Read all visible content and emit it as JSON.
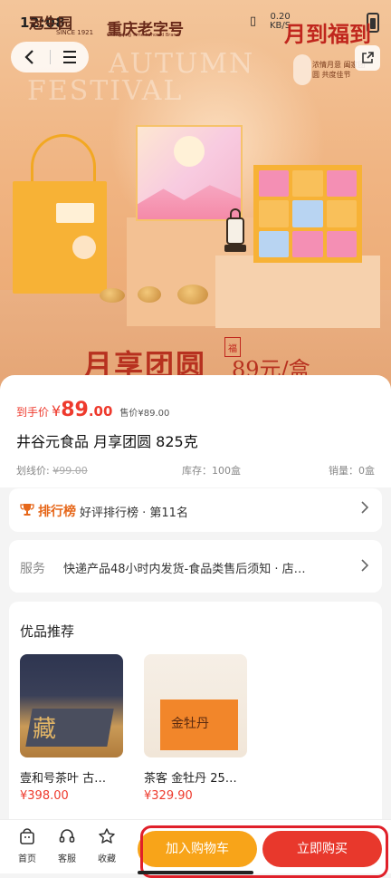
{
  "status_bar": {
    "time": "12:08",
    "network_speed": "0.20",
    "network_unit": "KB/S"
  },
  "hero": {
    "brand_logo": "冠生园",
    "brand_since": "SINCE 1921",
    "brand_name": "重庆老字号",
    "brand_sub": "Chongqing Time-honored Brand",
    "bg_text_line1": "AUTUMN",
    "bg_text_line2": "FESTIVAL",
    "badge_title": "月到福到",
    "badge_text": "浓情月意 阖家团圆 共度佳节",
    "slogan": "月享团圆",
    "seal": "福",
    "slogan_price": "89元/盒"
  },
  "product": {
    "price_tag": "到手价",
    "currency": "¥",
    "price_int": "89",
    "price_dec": ".00",
    "sale_label": "售价",
    "sale_currency": "¥",
    "sale_value": "89.00",
    "title": "井谷元食品 月享团圆 825克",
    "orig_label": "划线价:",
    "orig_price": "¥99.00",
    "stock": "库存：100盒",
    "sales": "销量：0盒"
  },
  "ranking": {
    "title": "排行榜",
    "text": "好评排行榜 · 第11名"
  },
  "service": {
    "label": "服务",
    "text": "快递产品48小时内发货-食品类售后须知 · 店…"
  },
  "recommend": {
    "title": "优品推荐",
    "items": [
      {
        "name": "壹和号茶叶 古…",
        "price": "¥398.00",
        "box_label": "藏"
      },
      {
        "name": "茶客 金牡丹 25…",
        "price": "¥329.90",
        "box_label": "金牡丹"
      }
    ]
  },
  "bottom_bar": {
    "home": "首页",
    "service": "客服",
    "favorite": "收藏",
    "add_cart": "加入购物车",
    "buy_now": "立即购买"
  },
  "colors": {
    "accent_red": "#e8382c",
    "accent_orange": "#f8a419",
    "price_red": "#ee3a2d"
  },
  "icons": [
    "back-icon",
    "menu-icon",
    "share-icon",
    "trophy-icon",
    "chevron-right-icon",
    "home-icon",
    "headset-icon",
    "star-icon"
  ]
}
